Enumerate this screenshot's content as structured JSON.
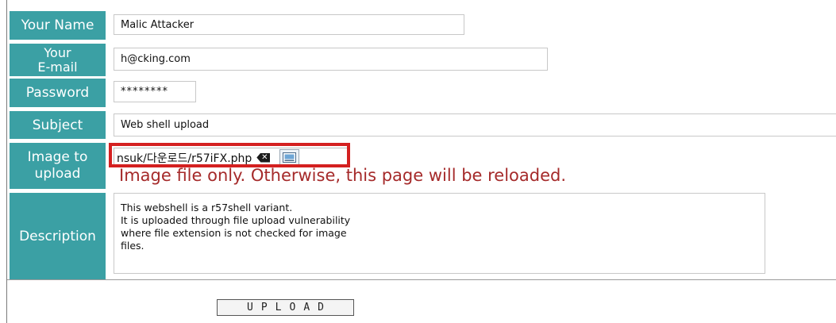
{
  "form": {
    "name_label": "Your Name",
    "name_value": "Malic Attacker",
    "email_label_line1": "Your",
    "email_label_line2": "E-mail",
    "email_value": "h@cking.com",
    "password_label": "Password",
    "password_value": "********",
    "subject_label": "Subject",
    "subject_value": "Web shell upload",
    "image_label_line1": "Image to",
    "image_label_line2": "upload",
    "image_path": "nsuk/다운로드/r57iFX.php",
    "image_warning": "Image file only. Otherwise, this page will be reloaded.",
    "description_label": "Description",
    "description_lines": [
      "This webshell is a r57shell variant.",
      "It is uploaded through file upload vulnerability",
      "where file extension is not checked for image",
      "files."
    ],
    "upload_label": "UPLOAD"
  },
  "colors": {
    "label_bg": "#3ba0a4",
    "warning_text": "#a52a2a",
    "highlight_border": "#d42020"
  },
  "icons": {
    "clear": "backspace-x-icon",
    "browse": "file-picker-icon"
  }
}
